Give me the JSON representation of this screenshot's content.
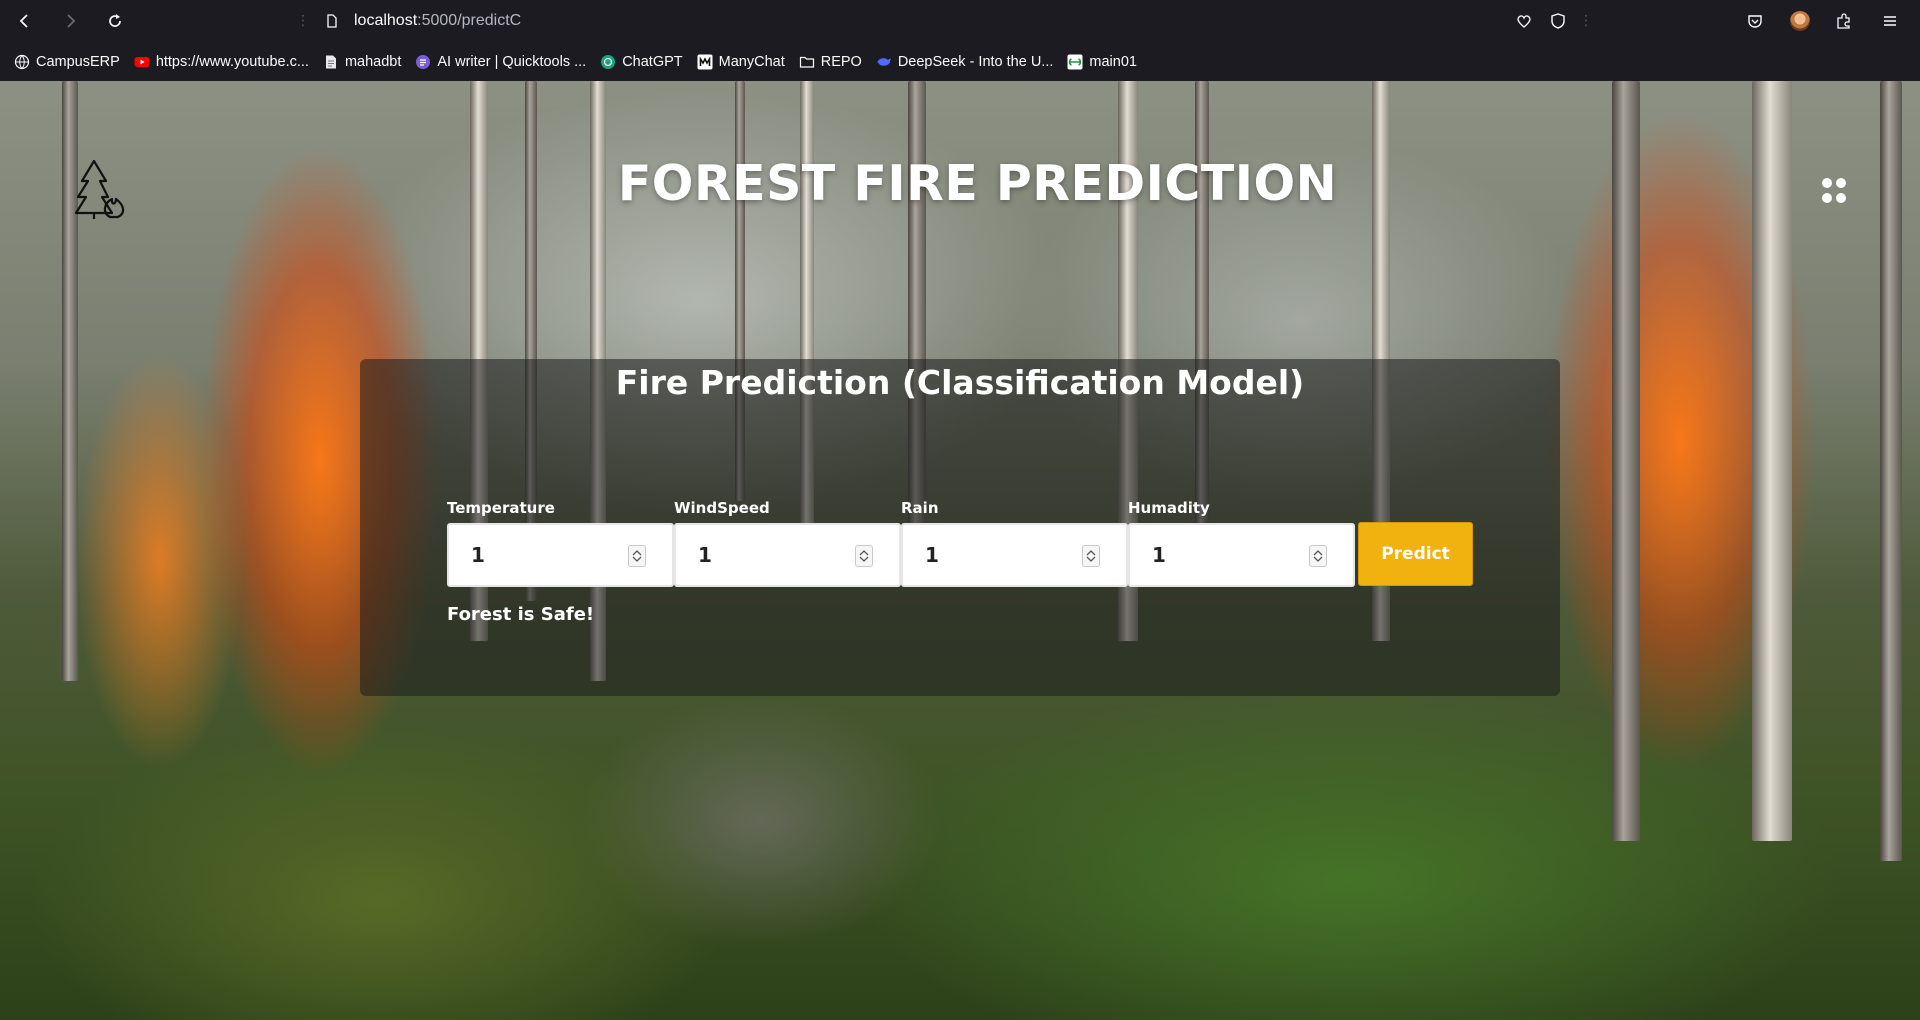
{
  "browser": {
    "url_host": "localhost",
    "url_path": ":5000/predictC",
    "bookmarks": [
      {
        "label": "CampusERP",
        "icon": "globe-icon"
      },
      {
        "label": "https://www.youtube.c...",
        "icon": "youtube-icon"
      },
      {
        "label": "mahadbt",
        "icon": "document-icon"
      },
      {
        "label": "AI writer | Quicktools ...",
        "icon": "quicktools-icon"
      },
      {
        "label": "ChatGPT",
        "icon": "chatgpt-icon"
      },
      {
        "label": "ManyChat",
        "icon": "manychat-icon"
      },
      {
        "label": "REPO",
        "icon": "folder-icon"
      },
      {
        "label": "DeepSeek - Into the U...",
        "icon": "deepseek-icon"
      },
      {
        "label": "main01",
        "icon": "geeksforgeeks-icon"
      }
    ]
  },
  "page": {
    "title": "FOREST FIRE PREDICTION",
    "card_title": "Fire Prediction (Classification Model)",
    "fields": [
      {
        "label": "Temperature",
        "value": "1"
      },
      {
        "label": "WindSpeed",
        "value": "1"
      },
      {
        "label": "Rain",
        "value": "1"
      },
      {
        "label": "Humadity",
        "value": "1"
      }
    ],
    "predict_label": "Predict",
    "result": "Forest is Safe!"
  },
  "colors": {
    "accent": "#f1b20f",
    "chrome": "#1c1b22"
  }
}
